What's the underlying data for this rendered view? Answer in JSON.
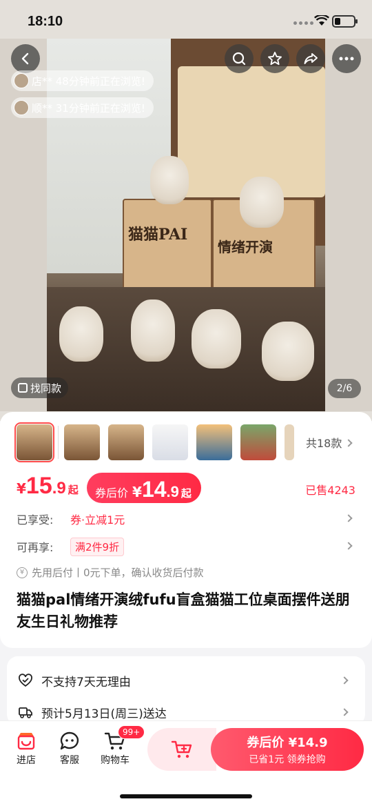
{
  "status_bar": {
    "time": "18:10"
  },
  "hero": {
    "browsing": [
      {
        "text": "店** 48分钟前正在浏览!"
      },
      {
        "text": "顺** 31分钟前正在浏览!"
      }
    ],
    "find_same_label": "找同款",
    "image_counter": "2/6",
    "box_text_1": "猫猫PAI",
    "box_text_2": "情绪开演"
  },
  "gallery": {
    "total_label": "共18款"
  },
  "price": {
    "currency": "¥",
    "integer": "15",
    "decimal": ".9",
    "suffix": "起",
    "coupon_label": "券后价",
    "coupon_currency": "¥",
    "coupon_integer": "14",
    "coupon_decimal": ".9",
    "coupon_suffix": "起",
    "sold_label": "已售4243"
  },
  "benefits": {
    "enjoyed_key": "已享受:",
    "enjoyed_value": "券·立减1元",
    "more_key": "可再享:",
    "more_tag": "满2件9折"
  },
  "pay_after": {
    "text": "先用后付丨0元下单，确认收货后付款"
  },
  "product_title": "猫猫pal情绪开演绒fufu盲盒猫猫工位桌面摆件送朋友生日礼物推荐",
  "services": [
    {
      "label": "不支持7天无理由"
    },
    {
      "label": "预计5月13日(周三)送达"
    }
  ],
  "bottom_bar": {
    "store_label": "进店",
    "service_label": "客服",
    "cart_label": "购物车",
    "cart_badge": "99+",
    "buy_main": "券后价 ¥14.9",
    "buy_sub": "已省1元  领券抢购"
  },
  "colors": {
    "accent": "#ff2a44",
    "accent_light": "#ffe9ec"
  }
}
